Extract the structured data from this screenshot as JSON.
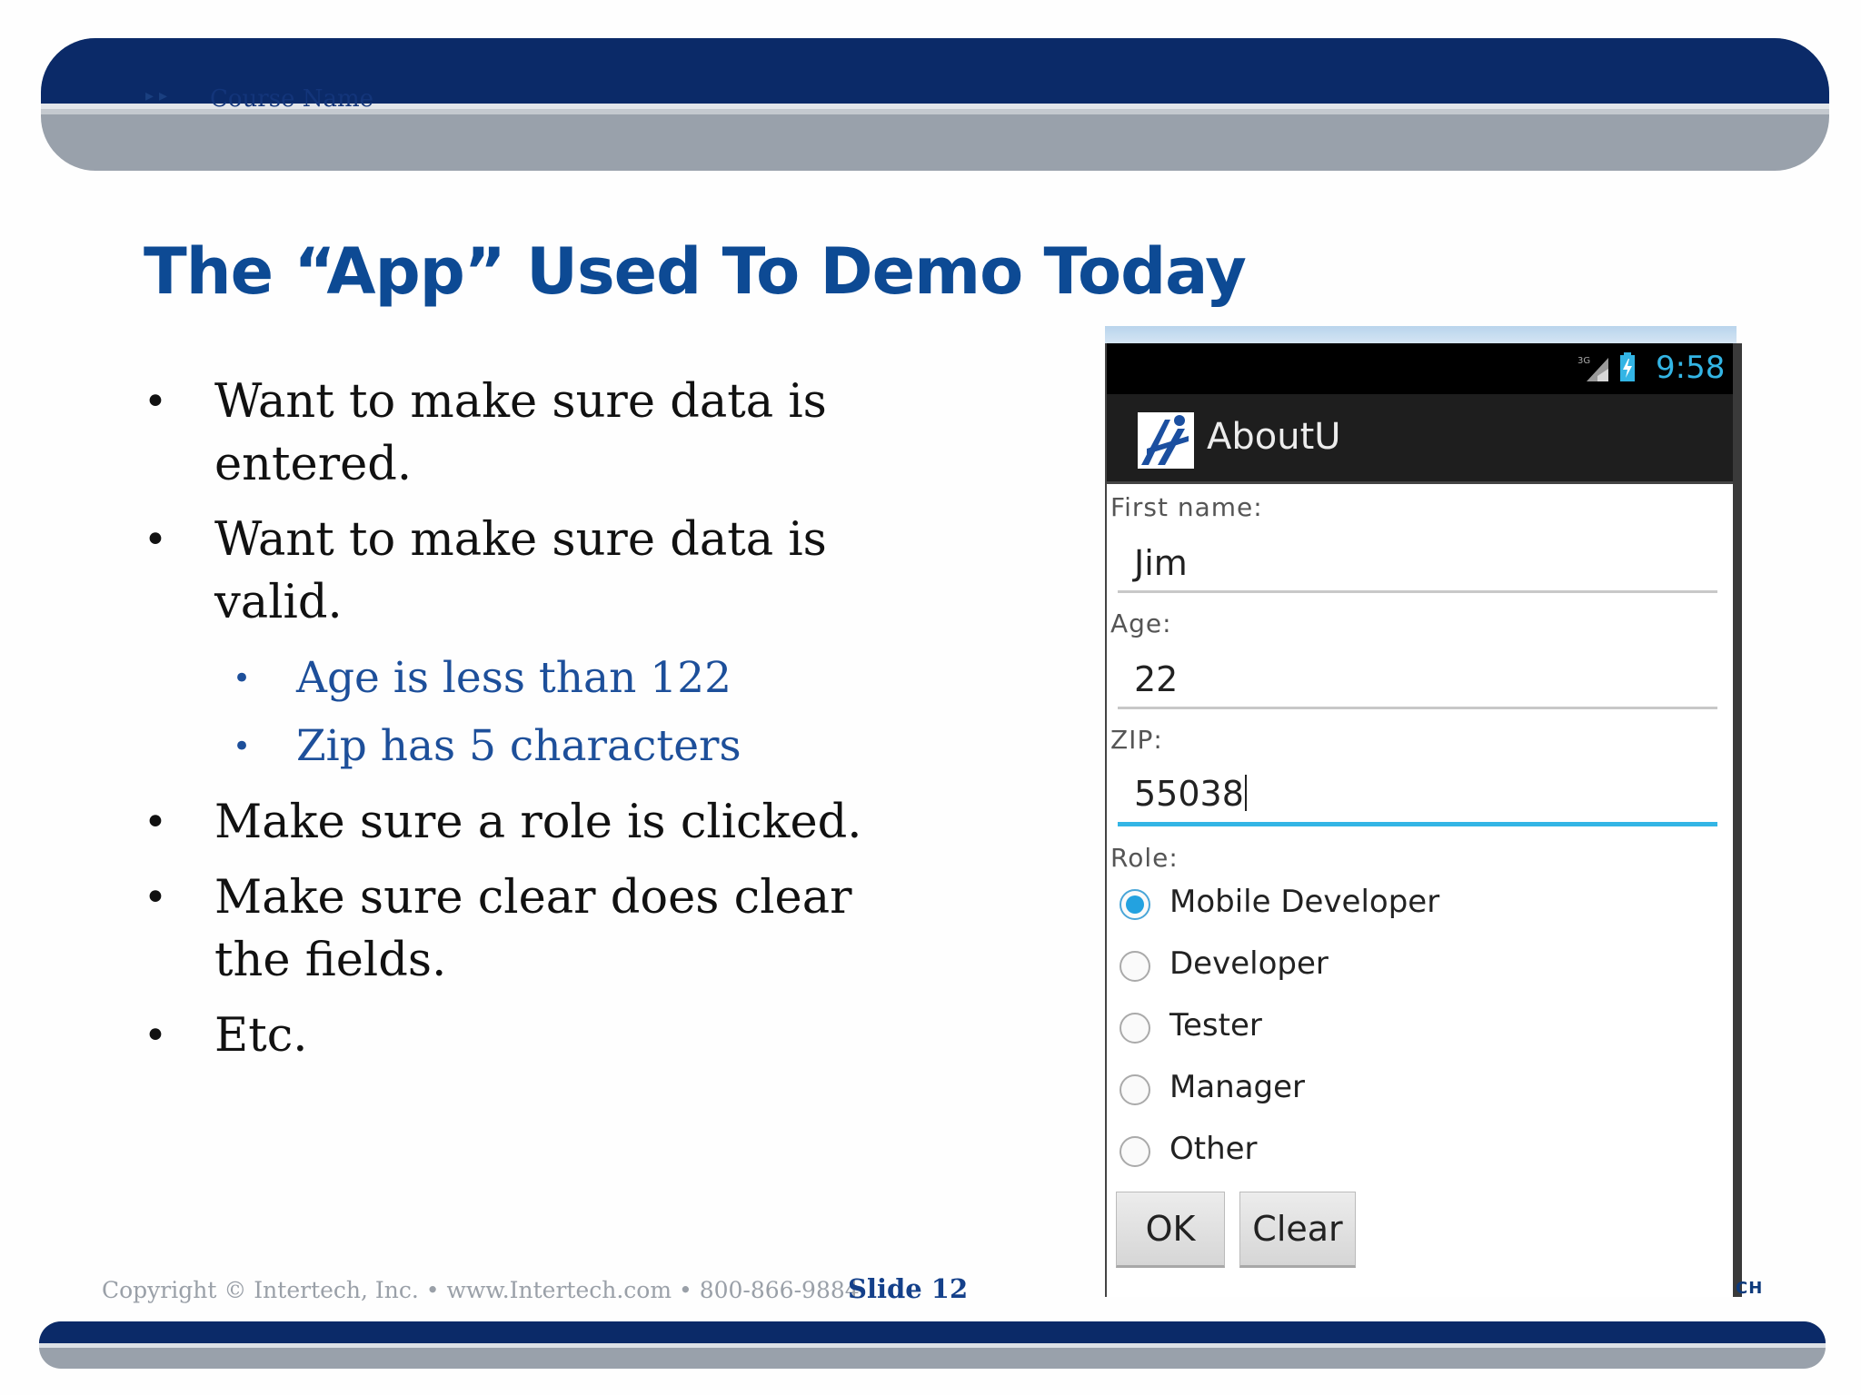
{
  "header": {
    "course_name": "Course Name"
  },
  "slide": {
    "title": "The “App” Used To Demo Today",
    "bullets": [
      {
        "text": "Want to make sure data is entered."
      },
      {
        "text": "Want to make sure data is valid."
      },
      {
        "text": "Age is less than 122",
        "level": 2
      },
      {
        "text": "Zip has 5 characters",
        "level": 2
      },
      {
        "text": "Make sure a role is clicked."
      },
      {
        "text": "Make sure clear does clear the fields."
      },
      {
        "text": "Etc."
      }
    ],
    "bullet_glyph": "•"
  },
  "footer": {
    "copyright": "Copyright © Intertech, Inc. • www.Intertech.com • 800-866-9884",
    "slide_number": "Slide 12",
    "logo_fragment": "CH"
  },
  "phone": {
    "status": {
      "network": "3G",
      "time": "9:58"
    },
    "app_title": "AboutU",
    "fields": {
      "first_name": {
        "label": "First name:",
        "value": "Jim"
      },
      "age": {
        "label": "Age:",
        "value": "22"
      },
      "zip": {
        "label": "ZIP:",
        "value": "55038"
      }
    },
    "role_label": "Role:",
    "roles": [
      {
        "label": "Mobile Developer",
        "selected": true
      },
      {
        "label": "Developer",
        "selected": false
      },
      {
        "label": "Tester",
        "selected": false
      },
      {
        "label": "Manager",
        "selected": false
      },
      {
        "label": "Other",
        "selected": false
      }
    ],
    "buttons": {
      "ok": "OK",
      "clear": "Clear"
    }
  },
  "colors": {
    "header_navy": "#0b2a68",
    "title_blue": "#0d4a94",
    "sub_bullet_blue": "#1d4f9a",
    "holo_blue": "#33b5e5"
  }
}
